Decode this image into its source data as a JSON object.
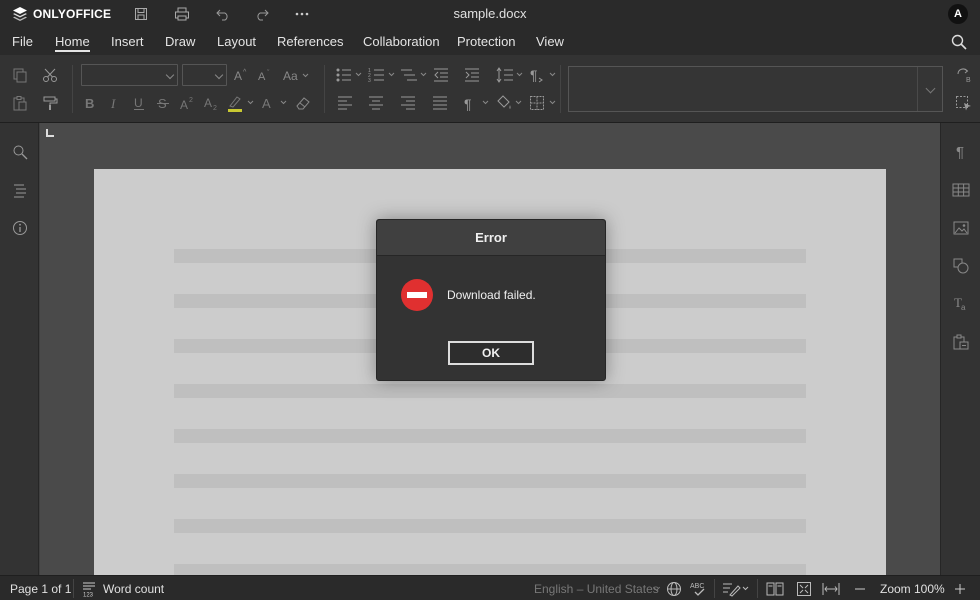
{
  "app": {
    "brand": "ONLYOFFICE",
    "doc_title": "sample.docx",
    "user_initial": "A"
  },
  "menu": {
    "tabs": [
      {
        "label": "File"
      },
      {
        "label": "Home"
      },
      {
        "label": "Insert"
      },
      {
        "label": "Draw"
      },
      {
        "label": "Layout"
      },
      {
        "label": "References"
      },
      {
        "label": "Collaboration"
      },
      {
        "label": "Protection"
      },
      {
        "label": "View"
      }
    ],
    "active_tab": "Home"
  },
  "toolbar": {
    "font_name": "",
    "font_size": "",
    "style_preview": ""
  },
  "dialog": {
    "title": "Error",
    "message": "Download failed.",
    "ok_label": "OK"
  },
  "status": {
    "page_info": "Page 1 of 1",
    "word_count": "Word count",
    "language": "English – United States",
    "zoom": "Zoom 100%"
  },
  "colors": {
    "error_icon": "#e03030",
    "chrome_bg": "#2a2a2a",
    "toolbar_bg": "#333333",
    "page_bg": "#cccccc"
  }
}
